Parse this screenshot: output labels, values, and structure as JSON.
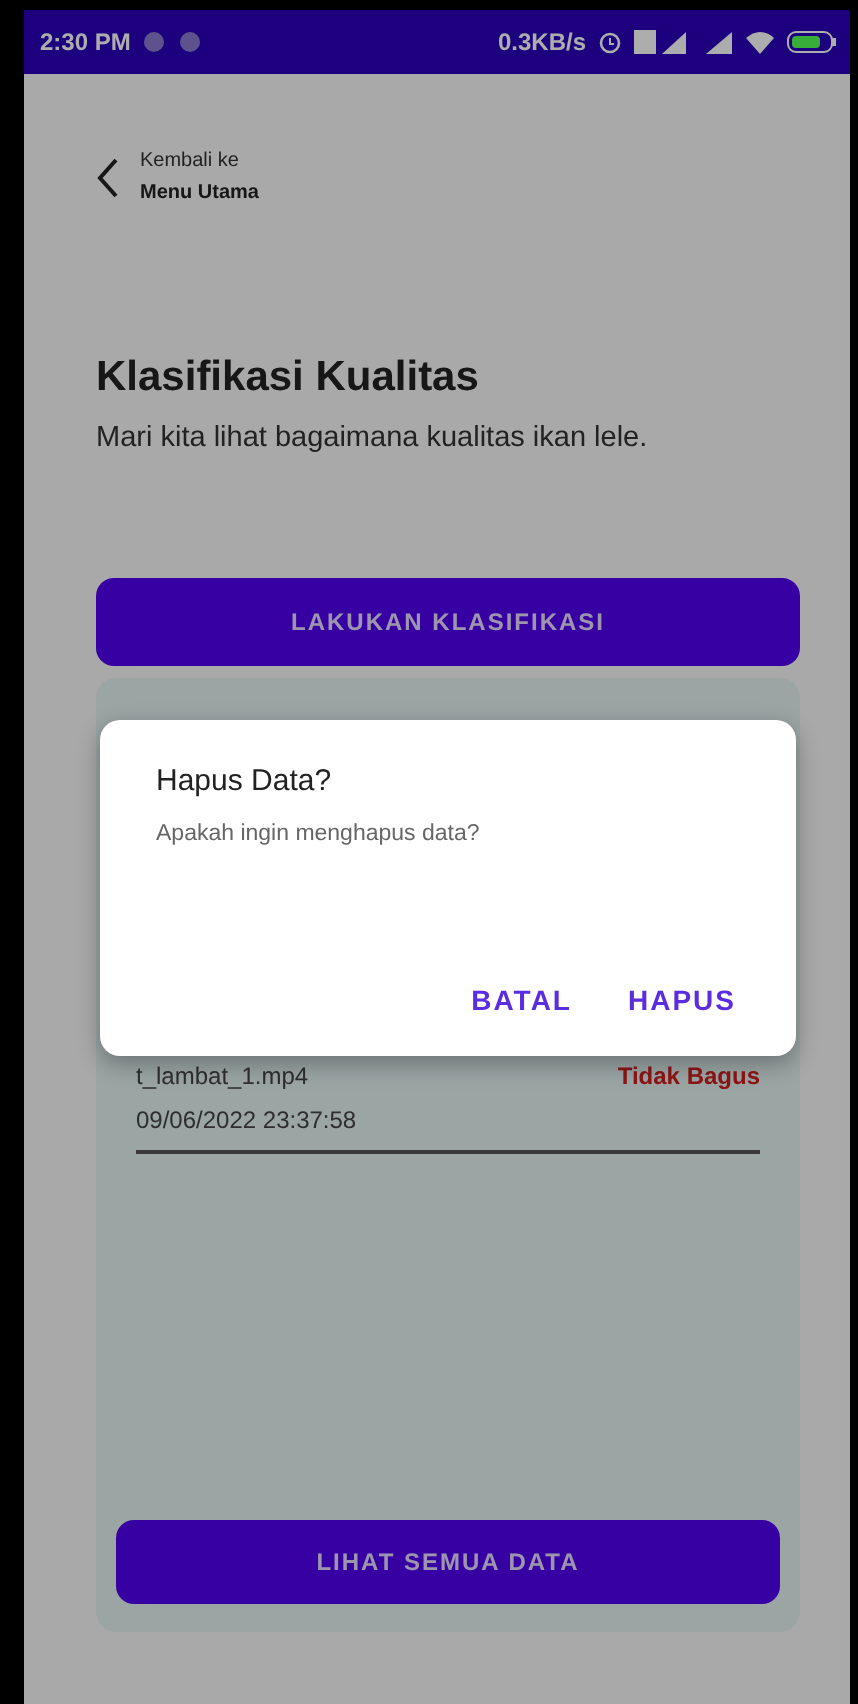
{
  "status_bar": {
    "time": "2:30 PM",
    "net_speed": "0.3KB/s"
  },
  "header": {
    "back_label": "Kembali ke",
    "back_title": "Menu Utama"
  },
  "title": "Klasifikasi Kualitas",
  "subtitle": "Mari kita lihat bagaimana kualitas ikan lele.",
  "classify_button": "LAKUKAN KLASIFIKASI",
  "history": {
    "items": [
      {
        "filename": "t_lambat_1.mp4",
        "result": "Tidak Bagus",
        "datetime": "09/06/2022 23:37:58"
      }
    ],
    "button": "LIHAT SEMUA DATA"
  },
  "dialog": {
    "title": "Hapus Data?",
    "message": "Apakah ingin menghapus data?",
    "buttons": [
      {
        "label": "BATAL"
      },
      {
        "label": "HAPUS"
      }
    ]
  }
}
